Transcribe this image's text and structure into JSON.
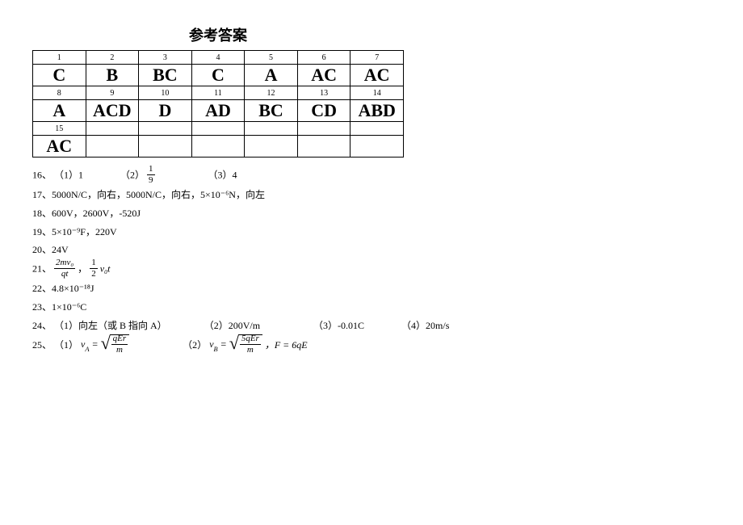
{
  "title": "参考答案",
  "table": {
    "rows": [
      {
        "nums": [
          "1",
          "2",
          "3",
          "4",
          "5",
          "6",
          "7"
        ],
        "answers": [
          "C",
          "B",
          "BC",
          "C",
          "A",
          "AC",
          "AC"
        ]
      },
      {
        "nums": [
          "8",
          "9",
          "10",
          "11",
          "12",
          "13",
          "14"
        ],
        "answers": [
          "A",
          "ACD",
          "D",
          "AD",
          "BC",
          "CD",
          "ABD"
        ]
      },
      {
        "nums": [
          "15",
          "",
          "",
          "",
          "",
          "",
          ""
        ],
        "answers": [
          "AC",
          "",
          "",
          "",
          "",
          "",
          ""
        ]
      }
    ]
  },
  "q16": {
    "label": "16、",
    "p1": "（1）1",
    "p2": "（2）",
    "frac_num": "1",
    "frac_den": "9",
    "p3": "（3）4"
  },
  "q17": {
    "label": "17、",
    "text": "5000N/C，向右，5000N/C，向右，5×10⁻⁶N，向左"
  },
  "q18": {
    "label": "18、",
    "text": "600V，2600V，-520J"
  },
  "q19": {
    "label": "19、",
    "text": "5×10⁻⁹F，220V"
  },
  "q20": {
    "label": "20、",
    "text": "24V"
  },
  "q21": {
    "label": "21、",
    "frac1_num": "2mv₀",
    "frac1_den": "qt",
    "sep": "，",
    "frac2_num": "1",
    "frac2_den": "2",
    "tail": " v₀t"
  },
  "q22": {
    "label": "22、",
    "text": "4.8×10⁻¹⁸J"
  },
  "q23": {
    "label": "23、",
    "text": "1×10⁻⁶C"
  },
  "q24": {
    "label": "24、",
    "p1": "（1）向左（或 B 指向 A）",
    "p2": "（2）200V/m",
    "p3": "（3）-0.01C",
    "p4": "（4）20m/s"
  },
  "q25": {
    "label": "25、",
    "p1": "（1）",
    "lhs1": "v_A =",
    "r1_num": "qEr",
    "r1_den": "m",
    "p2": "（2）",
    "lhs2": "v_B =",
    "r2_num": "5qEr",
    "r2_den": "m",
    "tail": "，F = 6qE"
  }
}
